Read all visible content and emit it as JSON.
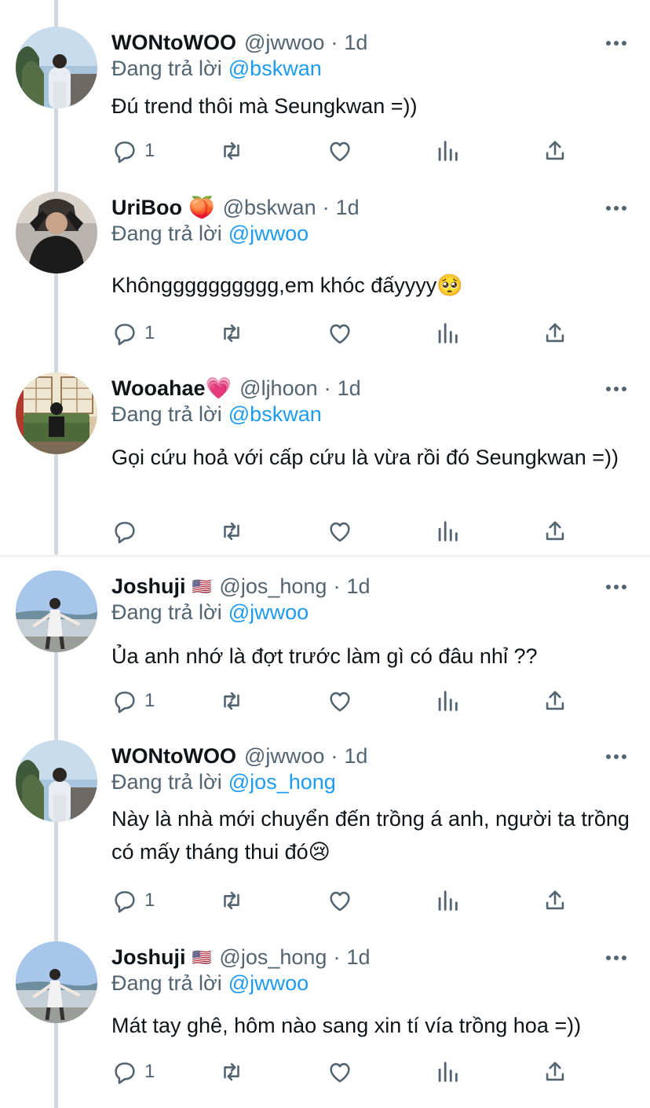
{
  "tweets": [
    {
      "name": "WONtoWOO",
      "emoji": "",
      "handle": "@jwwoo",
      "time": "1d",
      "reply_prefix": "Đang trả lời",
      "reply_to": "@bskwan",
      "text": "Đú trend thôi mà Seungkwan =))",
      "reply_count": "1",
      "avatar": "avatar-wontowoo"
    },
    {
      "name": "UriBoo",
      "emoji": "🍑",
      "handle": "@bskwan",
      "time": "1d",
      "reply_prefix": "Đang trả lời",
      "reply_to": "@jwwoo",
      "text": "Khôngggggggggg,em khóc đấyyyy🥺",
      "reply_count": "1",
      "avatar": "avatar-uriboo"
    },
    {
      "name": "Wooahae",
      "emoji": "💗",
      "handle": "@ljhoon",
      "time": "1d",
      "reply_prefix": "Đang trả lời",
      "reply_to": "@bskwan",
      "text": "Gọi cứu hoả với cấp cứu là vừa rồi đó Seungkwan =))",
      "reply_count": "",
      "avatar": "avatar-wooahae"
    },
    {
      "name": "Joshuji",
      "emoji": "🇺🇸",
      "handle": "@jos_hong",
      "time": "1d",
      "reply_prefix": "Đang trả lời",
      "reply_to": "@jwwoo",
      "text": "Ủa anh nhớ là đợt trước làm gì có đâu nhỉ ??",
      "reply_count": "1",
      "avatar": "avatar-joshuji"
    },
    {
      "name": "WONtoWOO",
      "emoji": "",
      "handle": "@jwwoo",
      "time": "1d",
      "reply_prefix": "Đang trả lời",
      "reply_to": "@jos_hong",
      "text": "Này là nhà mới chuyển đến trồng á anh, người ta trồng có mấy tháng thui đó😢",
      "reply_count": "1",
      "avatar": "avatar-wontowoo"
    },
    {
      "name": "Joshuji",
      "emoji": "🇺🇸",
      "handle": "@jos_hong",
      "time": "1d",
      "reply_prefix": "Đang trả lời",
      "reply_to": "@jwwoo",
      "text": "Mát tay ghê, hôm nào sang xin tí vía trồng hoa =))",
      "reply_count": "1",
      "avatar": "avatar-joshuji"
    }
  ],
  "separator": "·",
  "colors": {
    "accent": "#1d9bf0",
    "muted": "#536471",
    "text": "#0f1419",
    "thread_line": "#cfd9de"
  }
}
